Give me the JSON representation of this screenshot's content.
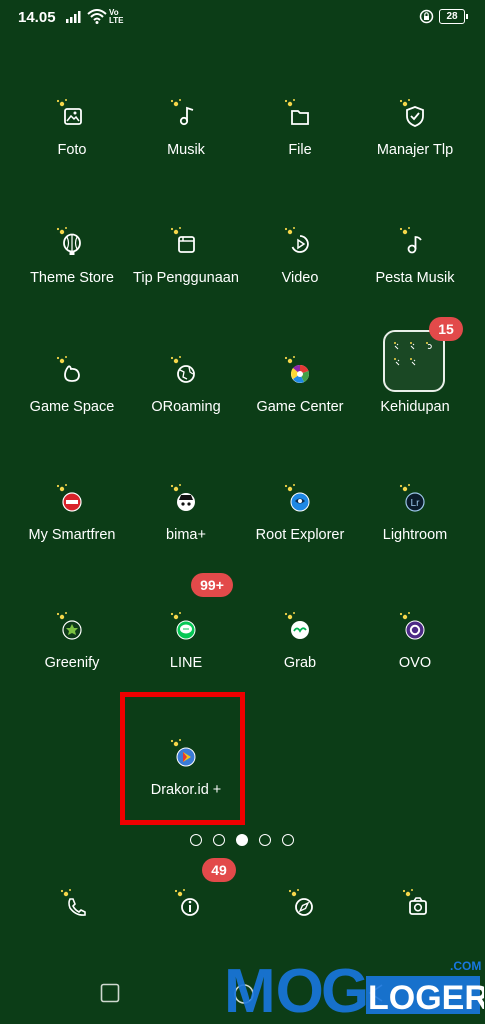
{
  "status": {
    "time": "14.05",
    "volte_top": "Vo",
    "volte_bottom": "LTE",
    "battery": "28"
  },
  "apps": [
    {
      "label": "Foto"
    },
    {
      "label": "Musik"
    },
    {
      "label": "File"
    },
    {
      "label": "Manajer Tlp"
    },
    {
      "label": "Theme Store"
    },
    {
      "label": "Tip Penggunaan"
    },
    {
      "label": "Video"
    },
    {
      "label": "Pesta Musik"
    },
    {
      "label": "Game Space"
    },
    {
      "label": "ORoaming"
    },
    {
      "label": "Game Center"
    },
    {
      "label": "Kehidupan"
    },
    {
      "label": "My Smartfren"
    },
    {
      "label": "bima+"
    },
    {
      "label": "Root Explorer"
    },
    {
      "label": "Lightroom"
    },
    {
      "label": "Greenify"
    },
    {
      "label": "LINE"
    },
    {
      "label": "Grab"
    },
    {
      "label": "OVO"
    },
    {
      "label": "Drakor.id +"
    }
  ],
  "badges": {
    "kehidupan": "15",
    "line": "99+",
    "phone": "49"
  },
  "page_indicator": {
    "pages": 5,
    "active_page": 3
  },
  "watermark": {
    "brand": "MOGLOGER",
    "suffix": ".COM"
  },
  "colors": {
    "background": "#0c3d17",
    "badge": "#e24a4a",
    "highlight": "#ee0000"
  }
}
